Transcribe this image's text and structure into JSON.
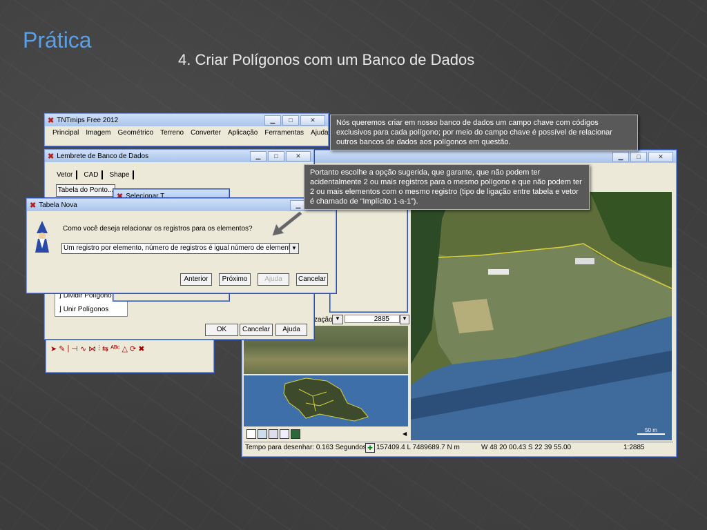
{
  "slide": {
    "title": "Prática",
    "subtitle": "4. Criar Polígonos com um Banco de Dados"
  },
  "main_window": {
    "title": "TNTmips Free 2012",
    "menu": [
      "Principal",
      "Imagem",
      "Geométrico",
      "Terreno",
      "Converter",
      "Aplicação",
      "Ferramentas",
      "Ajuda"
    ]
  },
  "reminder_window": {
    "title": "Lembrete de Banco de Dados",
    "tabs": [
      "Vetor",
      "CAD",
      "Shape"
    ],
    "table_button": "Tabela do Ponto...",
    "options": [
      "Dividir Polígono",
      "Unir Polígonos"
    ],
    "buttons": {
      "ok": "OK",
      "cancel": "Cancelar",
      "help": "Ajuda"
    }
  },
  "select_window": {
    "title": "Selecionar T..."
  },
  "new_table_dialog": {
    "title": "Tabela Nova",
    "question": "Como você deseja relacionar os registros para os elementos?",
    "selected_option": "Um registro por elemento, número de registros é igual número de elementos",
    "buttons": {
      "back": "Anterior",
      "next": "Próximo",
      "help": "Ajuda",
      "cancel": "Cancelar"
    }
  },
  "map_window": {
    "zoom_label": "zação",
    "zoom_value": "2885",
    "scale_bar": "50 m",
    "status": {
      "draw_time": "Tempo para desenhar: 0.163 Segundos",
      "coords": "157409.4 L  7489689.7 N m",
      "latlon": "W 48 20 00.43  S 22 39 55.00",
      "scale": "1:2885"
    }
  },
  "callouts": {
    "first": "Nós queremos criar em nosso banco de dados um campo chave com códigos exclusivos para cada polígono; por meio do campo chave é possível de relacionar outros bancos de dados aos polígonos em questão.",
    "second": "Portanto escolhe a opção sugerida, que garante, que não podem ter acidentalmente 2 ou mais registros para o mesmo polígono e que não podem ter 2 ou mais elementos com o mesmo registro (tipo de ligação entre tabela e vetor é chamado de “Implícito 1-a-1”)."
  },
  "colors": {
    "title_accent": "#5aa0e8",
    "callout_bg": "#595959"
  }
}
